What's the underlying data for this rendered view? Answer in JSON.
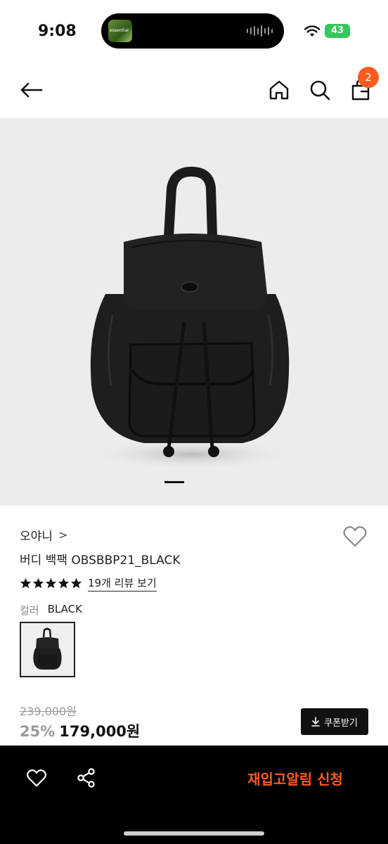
{
  "status_bar": {
    "time": "9:08",
    "island_label": "essential",
    "battery": "43"
  },
  "nav": {
    "back_icon": "arrow-left-icon",
    "home_icon": "home-icon",
    "search_icon": "search-icon",
    "cart_icon": "shopping-bag-icon",
    "cart_count": "2"
  },
  "product": {
    "brand": "오야니",
    "brand_chevron": ">",
    "name": "버디 백팩 OBSBBP21_BLACK",
    "rating_stars": 5,
    "review_link": "19개 리뷰 보기",
    "color_label": "컬러",
    "color_value": "BLACK",
    "original_price": "239,000원",
    "discount": "25%",
    "price": "179,000원",
    "coupon_label": "쿠폰받기",
    "image_page_index": 1
  },
  "bottom_bar": {
    "restock_label": "재입고알림 신청",
    "heart_icon": "heart-outline-icon",
    "share_icon": "share-icon"
  },
  "colors": {
    "accent": "#ff5a1f",
    "battery": "#34c759",
    "bottom_bar": "#000000"
  }
}
